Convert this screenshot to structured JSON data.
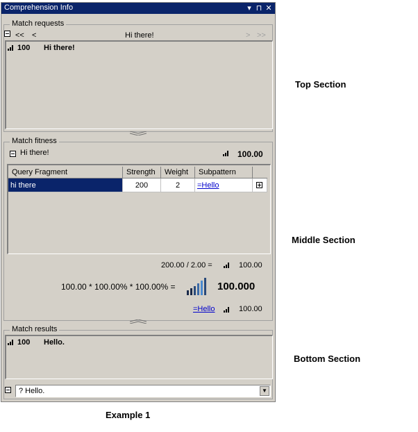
{
  "window": {
    "title": "Comprehension Info",
    "buttons": {
      "dropdown": "▾",
      "pin": "⊓",
      "close": "✕"
    }
  },
  "match_requests": {
    "label": "Match requests",
    "nav": {
      "first": "<<",
      "prev": "<",
      "current": "Hi there!",
      "next": ">",
      "last": ">>"
    },
    "items": [
      {
        "score": "100",
        "text": "Hi there!"
      }
    ]
  },
  "match_fitness": {
    "label": "Match fitness",
    "header": {
      "text": "Hi there!",
      "score": "100.00"
    },
    "columns": [
      "Query Fragment",
      "Strength",
      "Weight",
      "Subpattern"
    ],
    "rows": [
      {
        "fragment": "hi there",
        "strength": "200",
        "weight": "2",
        "subpattern": "=Hello"
      }
    ],
    "calc1": {
      "expr": "200.00 / 2.00 =",
      "score": "100.00"
    },
    "calc2": {
      "expr": "100.00 * 100.00% * 100.00% =",
      "score": "100.000"
    },
    "calc3": {
      "link": "=Hello",
      "score": "100.00"
    }
  },
  "match_results": {
    "label": "Match results",
    "items": [
      {
        "score": "100",
        "text": "Hello."
      }
    ],
    "input_value": "? Hello."
  },
  "annotations": {
    "top": "Top Section",
    "middle": "Middle Section",
    "bottom": "Bottom Section",
    "caption": "Example 1"
  }
}
